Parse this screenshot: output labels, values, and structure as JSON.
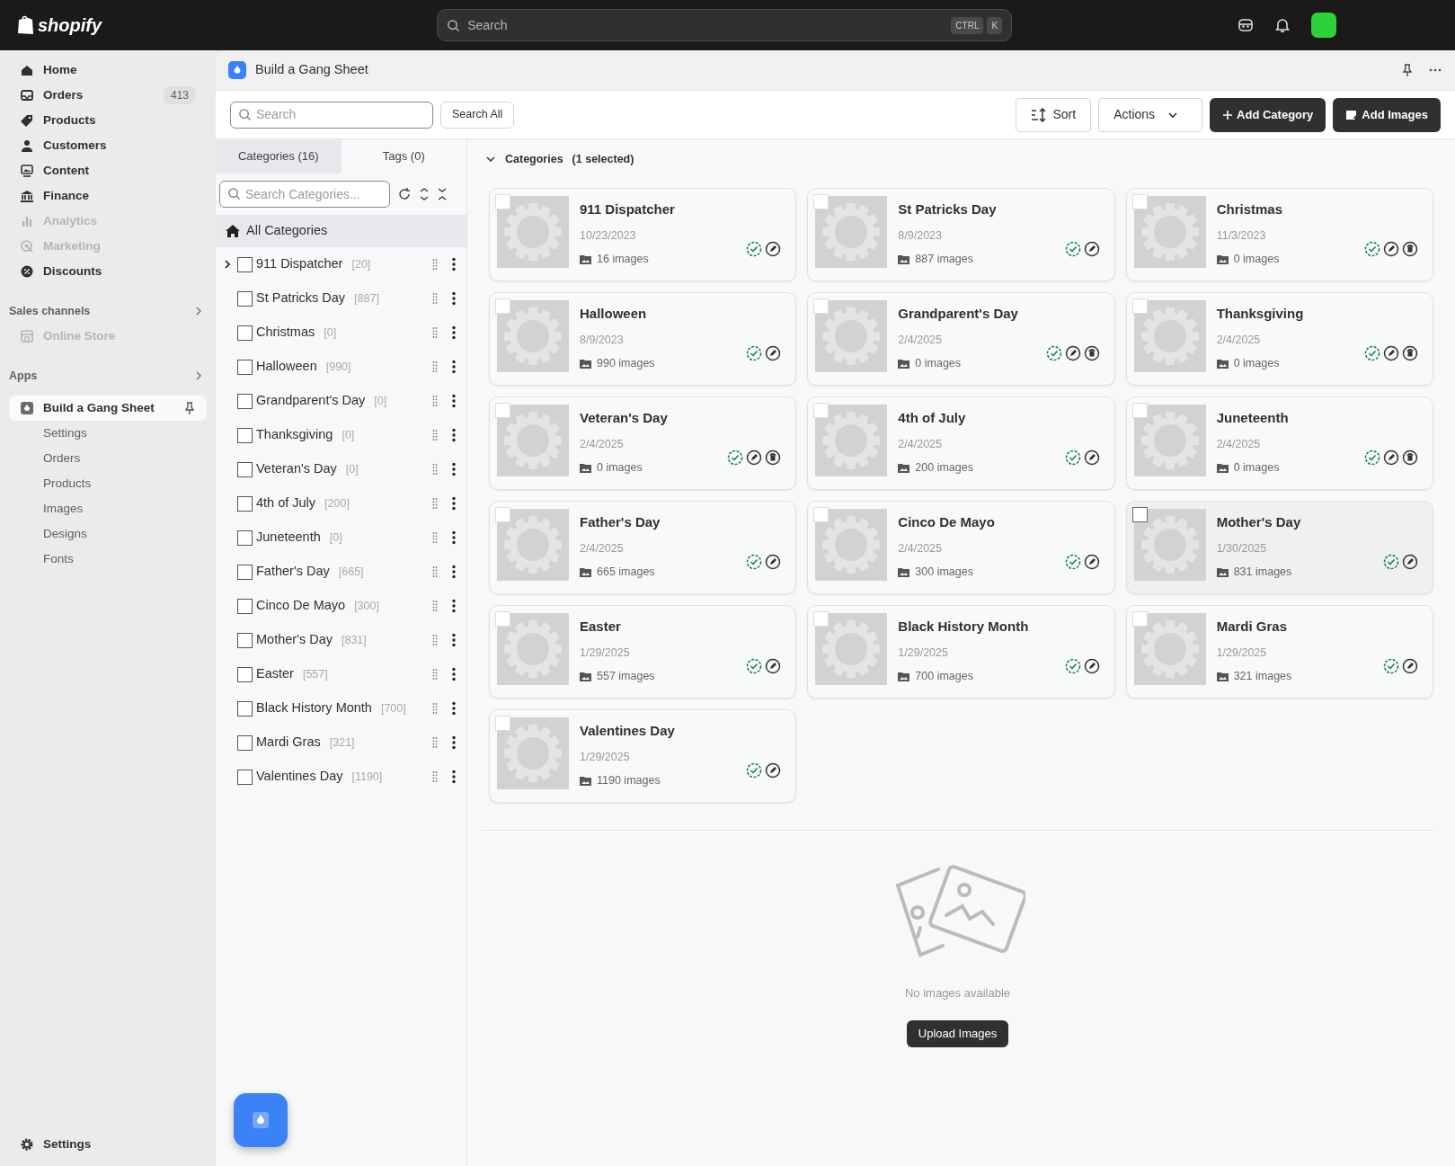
{
  "topbar": {
    "logo": "shopify",
    "search": {
      "placeholder": "Search"
    },
    "shortcut": [
      "CTRL",
      "K"
    ]
  },
  "sidebar": {
    "items": [
      {
        "label": "Home",
        "disabled": false
      },
      {
        "label": "Orders",
        "disabled": false,
        "badge": "413"
      },
      {
        "label": "Products",
        "disabled": false
      },
      {
        "label": "Customers",
        "disabled": false
      },
      {
        "label": "Content",
        "disabled": false
      },
      {
        "label": "Finance",
        "disabled": false
      },
      {
        "label": "Analytics",
        "disabled": true
      },
      {
        "label": "Marketing",
        "disabled": true
      },
      {
        "label": "Discounts",
        "disabled": false
      }
    ],
    "sales_channels": {
      "title": "Sales channels",
      "items": [
        {
          "label": "Online Store",
          "disabled": true
        }
      ]
    },
    "apps": {
      "title": "Apps",
      "app": {
        "label": "Build a Gang Sheet",
        "selected": true
      },
      "subitems": [
        "Settings",
        "Orders",
        "Products",
        "Images",
        "Designs",
        "Fonts"
      ]
    },
    "settings": "Settings"
  },
  "app_header": {
    "title": "Build a Gang Sheet"
  },
  "toolbar": {
    "search": {
      "placeholder": "Search"
    },
    "search_all": "Search All",
    "buttons": [
      {
        "label": "Sort",
        "kind": "sort"
      },
      {
        "label": "Actions",
        "kind": "dropdown"
      },
      {
        "label": "Add Category",
        "kind": "add"
      },
      {
        "label": "Add Images",
        "kind": "images"
      }
    ]
  },
  "tabs": [
    {
      "label": "Categories (16)",
      "selected": true
    },
    {
      "label": "Tags (0)",
      "selected": false
    }
  ],
  "category_search": {
    "placeholder": "Search Categories..."
  },
  "all_categories": {
    "label": "All Categories",
    "selected": true
  },
  "tree": [
    {
      "name": "911 Dispatcher",
      "count": "[20]",
      "checked": false,
      "expanded": false
    },
    {
      "name": "St Patricks Day",
      "count": "[887]",
      "checked": false
    },
    {
      "name": "Christmas",
      "count": "[0]",
      "checked": false
    },
    {
      "name": "Halloween",
      "count": "[990]",
      "checked": false
    },
    {
      "name": "Grandparent's Day",
      "count": "[0]",
      "checked": false
    },
    {
      "name": "Thanksgiving",
      "count": "[0]",
      "checked": false
    },
    {
      "name": "Veteran's Day",
      "count": "[0]",
      "checked": false
    },
    {
      "name": "4th of July",
      "count": "[200]",
      "checked": false
    },
    {
      "name": "Juneteenth",
      "count": "[0]",
      "checked": false
    },
    {
      "name": "Father's Day",
      "count": "[665]",
      "checked": false
    },
    {
      "name": "Cinco De Mayo",
      "count": "[300]",
      "checked": false
    },
    {
      "name": "Mother's Day",
      "count": "[831]",
      "checked": false
    },
    {
      "name": "Easter",
      "count": "[557]",
      "checked": false
    },
    {
      "name": "Black History Month",
      "count": "[700]",
      "checked": false
    },
    {
      "name": "Mardi Gras",
      "count": "[321]",
      "checked": false
    },
    {
      "name": "Valentines Day",
      "count": "[1190]",
      "checked": false
    }
  ],
  "section": {
    "title": "Categories",
    "note": "(1 selected)",
    "expanded": true
  },
  "cards": [
    {
      "name": "911 Dispatcher",
      "date": "10/23/2023",
      "images": "16 images",
      "selected": false,
      "checked": false,
      "deletable": false
    },
    {
      "name": "St Patricks Day",
      "date": "8/9/2023",
      "images": "887 images",
      "selected": false,
      "checked": false,
      "deletable": false
    },
    {
      "name": "Christmas",
      "date": "11/3/2023",
      "images": "0 images",
      "selected": false,
      "checked": false,
      "deletable": true
    },
    {
      "name": "Halloween",
      "date": "8/9/2023",
      "images": "990 images",
      "selected": false,
      "checked": false,
      "deletable": false
    },
    {
      "name": "Grandparent's Day",
      "date": "2/4/2025",
      "images": "0 images",
      "selected": false,
      "checked": false,
      "deletable": true
    },
    {
      "name": "Thanksgiving",
      "date": "2/4/2025",
      "images": "0 images",
      "selected": false,
      "checked": false,
      "deletable": true
    },
    {
      "name": "Veteran's Day",
      "date": "2/4/2025",
      "images": "0 images",
      "selected": false,
      "checked": false,
      "deletable": true
    },
    {
      "name": "4th of July",
      "date": "2/4/2025",
      "images": "200 images",
      "selected": false,
      "checked": false,
      "deletable": false
    },
    {
      "name": "Juneteenth",
      "date": "2/4/2025",
      "images": "0 images",
      "selected": false,
      "checked": false,
      "deletable": true
    },
    {
      "name": "Father's Day",
      "date": "2/4/2025",
      "images": "665 images",
      "selected": false,
      "checked": false,
      "deletable": false
    },
    {
      "name": "Cinco De Mayo",
      "date": "2/4/2025",
      "images": "300 images",
      "selected": false,
      "checked": false,
      "deletable": false
    },
    {
      "name": "Mother's Day",
      "date": "1/30/2025",
      "images": "831 images",
      "selected": true,
      "checked": false,
      "deletable": false
    },
    {
      "name": "Easter",
      "date": "1/29/2025",
      "images": "557 images",
      "selected": false,
      "checked": false,
      "deletable": false
    },
    {
      "name": "Black History Month",
      "date": "1/29/2025",
      "images": "700 images",
      "selected": false,
      "checked": false,
      "deletable": false
    },
    {
      "name": "Mardi Gras",
      "date": "1/29/2025",
      "images": "321 images",
      "selected": false,
      "checked": false,
      "deletable": false
    },
    {
      "name": "Valentines Day",
      "date": "1/29/2025",
      "images": "1190 images",
      "selected": false,
      "checked": false,
      "deletable": false
    }
  ],
  "empty_state": {
    "message": "No images available",
    "button": "Upload Images"
  }
}
